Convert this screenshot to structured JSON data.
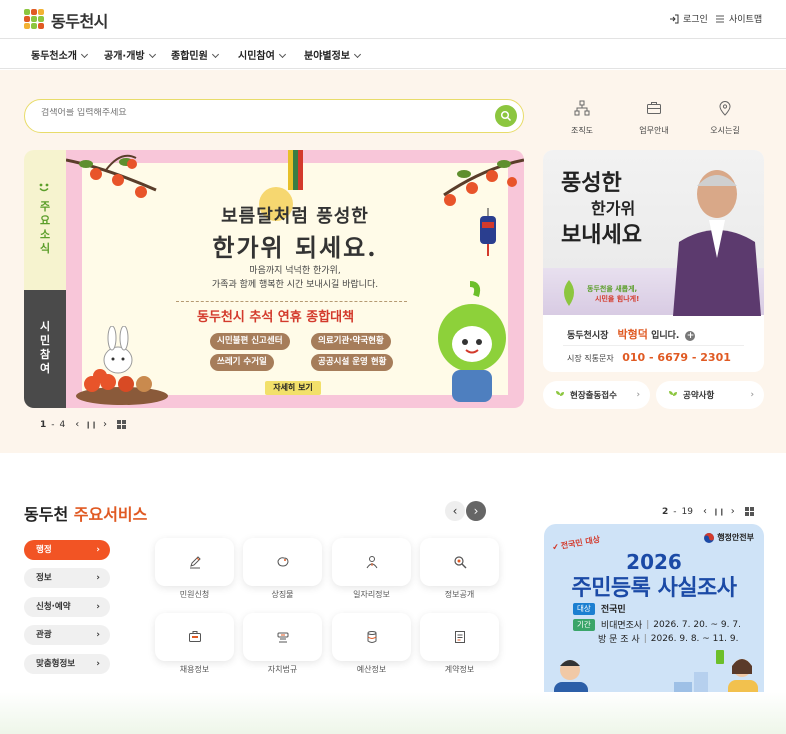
{
  "header": {
    "logo_text": "동두천시",
    "login": "로그인",
    "sitemap": "사이트맵"
  },
  "nav": {
    "items": [
      "동두천소개",
      "공개·개방",
      "종합민원",
      "시민참여",
      "분야별정보"
    ]
  },
  "search": {
    "placeholder": "검색어를 입력해주세요"
  },
  "quick_links": [
    "조직도",
    "업무안내",
    "오시는길"
  ],
  "side_tabs": {
    "news": "주요 소식",
    "participation": "시민 참여"
  },
  "banner": {
    "line1": "보름달처럼 풍성한",
    "line2": "한가위 되세요.",
    "sub1": "마음까지 넉넉한 한가위,",
    "sub2": "가족과 함께 행복한 시간 보내시길 바랍니다.",
    "headline": "동두천시 추석 연휴 종합대책",
    "pills": [
      "시민불편 신고센터",
      "의료기관·약국현황",
      "쓰레기 수거일",
      "공공시설 운영 현황"
    ],
    "more": "자세히 보기"
  },
  "banner_pager": {
    "current": "1",
    "sep": "-",
    "total": "4"
  },
  "mayor": {
    "calligraphy1": "풍성한",
    "calligraphy2": "한가위",
    "calligraphy3": "보내세요",
    "slogan1": "동두천을 새롭게,",
    "slogan2": "시민을 힘나게!",
    "title": "동두천시장",
    "name": "박형덕",
    "suffix": "입니다.",
    "phone_label": "시장 직통문자",
    "phone": "010 - 6679 - 2301"
  },
  "mini_buttons": [
    "현장출동접수",
    "공약사항"
  ],
  "services": {
    "title_prefix": "동두천",
    "title_highlight": "주요서비스",
    "categories": [
      "행정",
      "정보",
      "신청·예약",
      "관광",
      "맞춤형정보"
    ],
    "items": [
      "민원신청",
      "상징물",
      "일자리정보",
      "정보공개",
      "채용정보",
      "자치법규",
      "예산정보",
      "계약정보"
    ]
  },
  "promo_pager": {
    "current": "2",
    "sep": "-",
    "total": "19"
  },
  "promo": {
    "badge": "전국민 대상",
    "ministry": "행정안전부",
    "year": "2026",
    "title": "주민등록 사실조사",
    "target_tag": "대상",
    "target": "전국민",
    "period_tag": "기간",
    "period1_label": "비대면조사",
    "period1": "2026. 7. 20. ~ 9. 7.",
    "period2_label": "방 문 조 사",
    "period2": "2026. 9. 8. ~ 11. 9."
  },
  "colors": {
    "accent_orange": "#e05a23",
    "hero_bg": "#fdf5ec",
    "green": "#8cc63f",
    "promo_blue": "#1b4aa6"
  }
}
